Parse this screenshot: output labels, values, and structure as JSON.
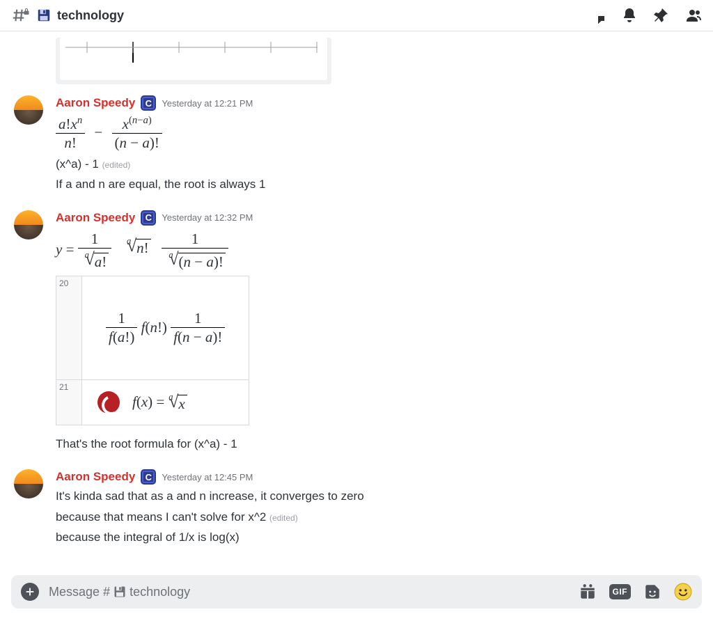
{
  "header": {
    "channel_name": "technology",
    "icons": {
      "hash": "hash-icon",
      "lock": "lock-icon",
      "save": "save-disk-icon",
      "threads": "threads-icon",
      "bell": "notifications-icon",
      "pin": "pinned-icon",
      "members": "members-icon"
    }
  },
  "messages": [
    {
      "author": "Aaron Speedy",
      "timestamp": "Yesterday at 12:21 PM",
      "attachment": {
        "type": "math-image",
        "formula_latex": "\\frac{a!x^{n}}{n!} - \\frac{x^{(n-a)}}{(n-a)!}"
      },
      "lines": [
        {
          "text": "(x^a) - 1",
          "edited": true,
          "edited_label": "(edited)"
        },
        {
          "text": "If a and n are equal, the root is always 1"
        }
      ]
    },
    {
      "author": "Aaron Speedy",
      "timestamp": "Yesterday at 12:32 PM",
      "attachment1": {
        "type": "math-image",
        "formula_latex": "y = \\frac{1}{\\sqrt[a]{a!}} \\; \\sqrt[a]{n!} \\; \\frac{1}{\\sqrt[a]{(n-a)!}}"
      },
      "attachment2": {
        "type": "two-row-panel",
        "rows": [
          {
            "n": "20",
            "formula_latex": "\\frac{1}{f(a!)} f(n!) \\frac{1}{f(n-a)!}"
          },
          {
            "n": "21",
            "formula_latex": "f(x) = \\sqrt[a]{x}",
            "has_swirl_icon": true
          }
        ]
      },
      "lines": [
        {
          "text": "That's the root formula for (x^a) - 1"
        }
      ]
    },
    {
      "author": "Aaron Speedy",
      "timestamp": "Yesterday at 12:45 PM",
      "lines": [
        {
          "text": "It's kinda sad that as a and n increase, it converges to zero"
        },
        {
          "text": "because that means I can't solve for x^2",
          "edited": true,
          "edited_label": "(edited)"
        },
        {
          "text": "because the integral of 1/x is log(x)"
        }
      ]
    }
  ],
  "composer": {
    "placeholder_prefix": "Message #",
    "placeholder_channel": "technology",
    "gif_label": "GIF"
  },
  "colors": {
    "author": "#d6312d",
    "muted": "#6e7178",
    "composer_bg": "#eceef0"
  }
}
